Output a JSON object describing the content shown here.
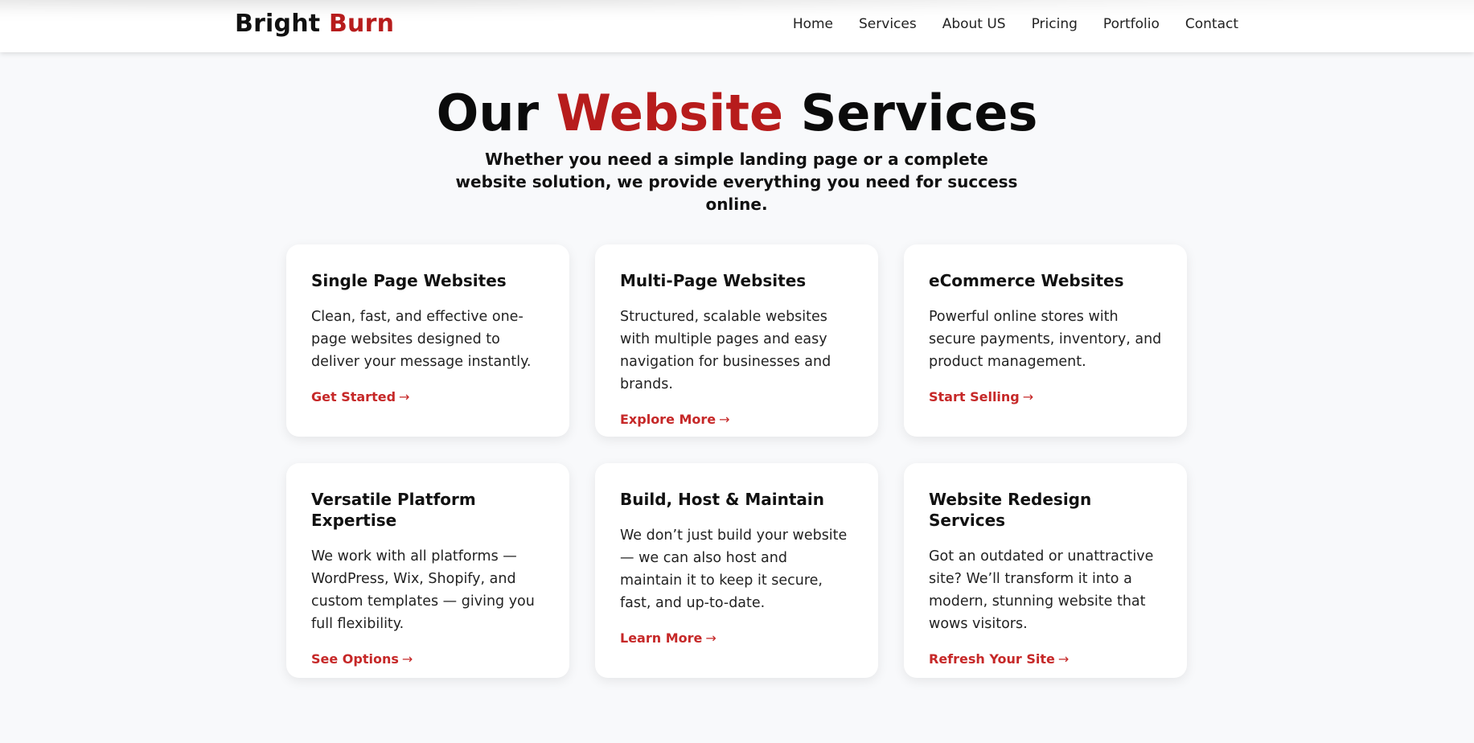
{
  "brand": {
    "name": "Bright",
    "accent": "Burn"
  },
  "nav": {
    "items": [
      "Home",
      "Services",
      "About US",
      "Pricing",
      "Portfolio",
      "Contact"
    ]
  },
  "hero": {
    "title_part1": "Our",
    "title_accent": "Website",
    "title_part2": "Services",
    "subtitle": "Whether you need a simple landing page or a complete website solution, we provide everything you need for success online."
  },
  "services": [
    {
      "title": "Single Page Websites",
      "description": "Clean, fast, and effective one-page websites designed to deliver your message instantly.",
      "cta": "Get Started"
    },
    {
      "title": "Multi-Page Websites",
      "description": "Structured, scalable websites with multiple pages and easy navigation for businesses and brands.",
      "cta": "Explore More"
    },
    {
      "title": "eCommerce Websites",
      "description": "Powerful online stores with secure payments, inventory, and product management.",
      "cta": "Start Selling"
    },
    {
      "title": "Versatile Platform Expertise",
      "description": "We work with all platforms — WordPress, Wix, Shopify, and custom templates — giving you full flexibility.",
      "cta": "See Options"
    },
    {
      "title": "Build, Host & Maintain",
      "description": "We don’t just build your website — we can also host and maintain it to keep it secure, fast, and up-to-date.",
      "cta": "Learn More"
    },
    {
      "title": "Website Redesign Services",
      "description": "Got an outdated or unattractive site? We’ll transform it into a modern, stunning website that wows visitors.",
      "cta": "Refresh Your Site"
    }
  ],
  "colors": {
    "accent": "#b71c1c",
    "cta": "#c62828",
    "background": "#f8f9fb",
    "card": "#ffffff"
  },
  "icons": {
    "cta_arrow": "right-arrow-icon"
  }
}
